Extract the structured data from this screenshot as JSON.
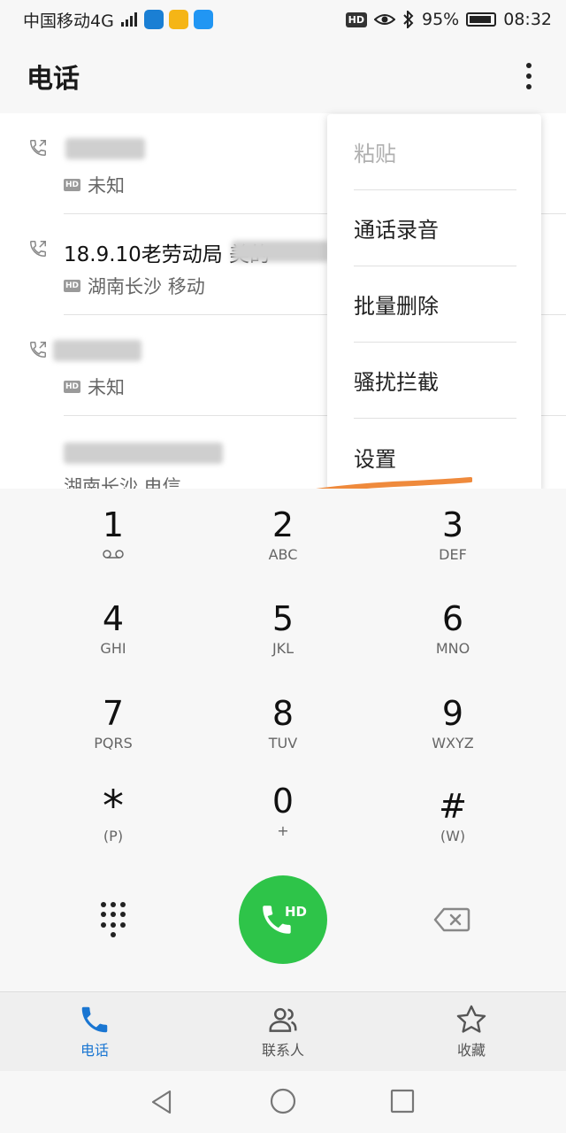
{
  "status_bar": {
    "carrier": "中国移动4G",
    "network_badge": "4G",
    "hd_label": "HD",
    "battery": "95%",
    "time": "08:32",
    "app_icon_colors": [
      "#1a7fd4",
      "#f5b516",
      "#2196f3"
    ]
  },
  "appbar": {
    "title": "电话",
    "more_icon": "more-vert-icon"
  },
  "call_log": [
    {
      "name": "",
      "name_blurred": true,
      "location": "未知"
    },
    {
      "name": "18.9.10老劳动局 美的",
      "name_blurred": true,
      "location": "湖南长沙 移动"
    },
    {
      "name": "",
      "name_blurred": true,
      "location": "未知"
    },
    {
      "name": "",
      "name_blurred": true,
      "location": "湖南长沙 电信"
    }
  ],
  "menu": {
    "items": [
      {
        "label": "粘贴",
        "disabled": true
      },
      {
        "label": "通话录音",
        "disabled": false
      },
      {
        "label": "批量删除",
        "disabled": false
      },
      {
        "label": "骚扰拦截",
        "disabled": false
      },
      {
        "label": "设置",
        "disabled": false
      }
    ],
    "annotation_color": "#ef8a3c"
  },
  "dialpad": {
    "keys": [
      {
        "num": "1",
        "letters": ""
      },
      {
        "num": "2",
        "letters": "ABC"
      },
      {
        "num": "3",
        "letters": "DEF"
      },
      {
        "num": "4",
        "letters": "GHI"
      },
      {
        "num": "5",
        "letters": "JKL"
      },
      {
        "num": "6",
        "letters": "MNO"
      },
      {
        "num": "7",
        "letters": "PQRS"
      },
      {
        "num": "8",
        "letters": "TUV"
      },
      {
        "num": "9",
        "letters": "WXYZ"
      },
      {
        "num": "*",
        "letters": "(P)"
      },
      {
        "num": "0",
        "letters": "+"
      },
      {
        "num": "#",
        "letters": "(W)"
      }
    ],
    "call_button_label": "HD",
    "call_button_color": "#2ec449"
  },
  "bottom_nav": {
    "tabs": [
      {
        "label": "电话",
        "active": true,
        "icon": "phone-icon"
      },
      {
        "label": "联系人",
        "active": false,
        "icon": "contacts-icon"
      },
      {
        "label": "收藏",
        "active": false,
        "icon": "star-icon"
      }
    ],
    "active_color": "#1a76d2"
  }
}
